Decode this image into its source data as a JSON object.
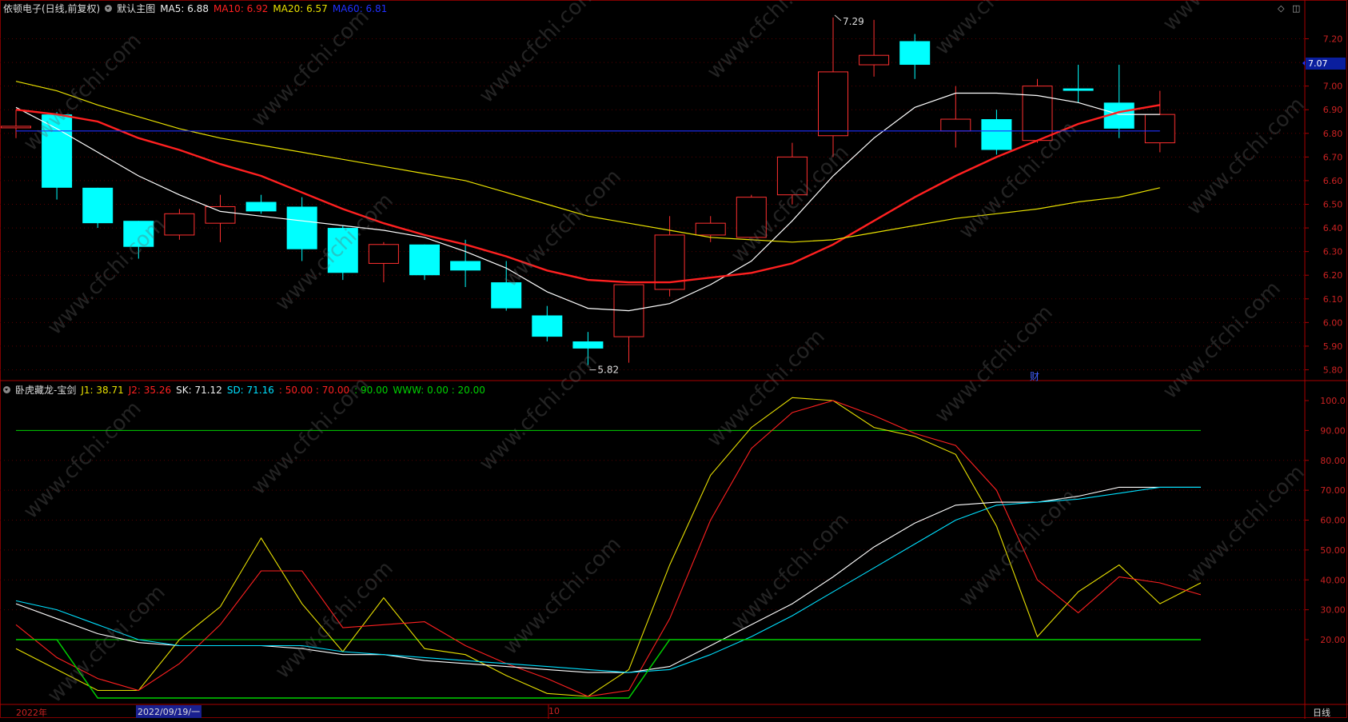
{
  "header_main": {
    "stock": "依顿电子(日线,前复权)",
    "chart_name": "默认主图",
    "ma5": "MA5: 6.88",
    "ma10": "MA10: 6.92",
    "ma20": "MA20: 6.57",
    "ma60": "MA60: 6.81"
  },
  "header_sub": {
    "indicator": "卧虎藏龙-宝剑",
    "j1": "J1: 38.71",
    "j2": "J2: 35.26",
    "sk": "SK: 71.12",
    "sd": "SD: 71.16",
    "lines_red": ": 50.00 : 70.00",
    "lines_green": ": 90.00",
    "www": "WWW: 0.00 : 20.00"
  },
  "current_price": "7.07",
  "finance_flag": "财",
  "bottom": {
    "year": "2022年",
    "date": "2022/09/19/一",
    "month": "10",
    "period": "日线"
  },
  "colors": {
    "up": "#ff3030",
    "down": "#00ffff",
    "ma5": "#ffffff",
    "ma10": "#ff2020",
    "ma20": "#e8e000",
    "ma60": "#2030ff",
    "j1": "#e8e000",
    "j2": "#ff2020",
    "sk": "#ffffff",
    "sd": "#00e0ff",
    "www": "#00d000"
  },
  "chart_data": [
    {
      "type": "candlestick",
      "title": "依顿电子(日线,前复权)",
      "ylim": [
        5.76,
        7.3
      ],
      "yticks": [
        "5.80",
        "5.90",
        "6.00",
        "6.10",
        "6.20",
        "6.30",
        "6.40",
        "6.50",
        "6.60",
        "6.70",
        "6.80",
        "6.90",
        "7.00",
        "7.10",
        "7.20"
      ],
      "annotations": [
        {
          "label": "7.29",
          "index": 20,
          "value": 7.29
        },
        {
          "label": "5.82",
          "index": 14,
          "value": 5.82
        }
      ],
      "candles": [
        {
          "o": 6.83,
          "h": 6.9,
          "l": 6.78,
          "c": 6.83
        },
        {
          "o": 6.88,
          "h": 6.89,
          "l": 6.52,
          "c": 6.57
        },
        {
          "o": 6.57,
          "h": 6.57,
          "l": 6.4,
          "c": 6.42
        },
        {
          "o": 6.43,
          "h": 6.43,
          "l": 6.27,
          "c": 6.32
        },
        {
          "o": 6.37,
          "h": 6.48,
          "l": 6.35,
          "c": 6.46
        },
        {
          "o": 6.42,
          "h": 6.54,
          "l": 6.34,
          "c": 6.49
        },
        {
          "o": 6.51,
          "h": 6.54,
          "l": 6.46,
          "c": 6.47
        },
        {
          "o": 6.49,
          "h": 6.53,
          "l": 6.26,
          "c": 6.31
        },
        {
          "o": 6.4,
          "h": 6.41,
          "l": 6.18,
          "c": 6.21
        },
        {
          "o": 6.25,
          "h": 6.34,
          "l": 6.17,
          "c": 6.33
        },
        {
          "o": 6.33,
          "h": 6.33,
          "l": 6.18,
          "c": 6.2
        },
        {
          "o": 6.26,
          "h": 6.35,
          "l": 6.15,
          "c": 6.22
        },
        {
          "o": 6.17,
          "h": 6.26,
          "l": 6.05,
          "c": 6.06
        },
        {
          "o": 6.03,
          "h": 6.07,
          "l": 5.92,
          "c": 5.94
        },
        {
          "o": 5.92,
          "h": 5.96,
          "l": 5.82,
          "c": 5.89
        },
        {
          "o": 5.94,
          "h": 6.16,
          "l": 5.83,
          "c": 6.16
        },
        {
          "o": 6.14,
          "h": 6.45,
          "l": 6.11,
          "c": 6.37
        },
        {
          "o": 6.37,
          "h": 6.45,
          "l": 6.34,
          "c": 6.42
        },
        {
          "o": 6.36,
          "h": 6.54,
          "l": 6.36,
          "c": 6.53
        },
        {
          "o": 6.54,
          "h": 6.76,
          "l": 6.5,
          "c": 6.7
        },
        {
          "o": 6.79,
          "h": 7.29,
          "l": 6.7,
          "c": 7.06
        },
        {
          "o": 7.09,
          "h": 7.28,
          "l": 7.04,
          "c": 7.13
        },
        {
          "o": 7.19,
          "h": 7.22,
          "l": 7.03,
          "c": 7.09
        },
        {
          "o": 6.81,
          "h": 7.0,
          "l": 6.74,
          "c": 6.86
        },
        {
          "o": 6.86,
          "h": 6.9,
          "l": 6.71,
          "c": 6.73
        },
        {
          "o": 6.77,
          "h": 7.03,
          "l": 6.76,
          "c": 7.0
        },
        {
          "o": 6.99,
          "h": 7.09,
          "l": 6.93,
          "c": 6.98
        },
        {
          "o": 6.93,
          "h": 7.09,
          "l": 6.78,
          "c": 6.82
        },
        {
          "o": 6.76,
          "h": 6.98,
          "l": 6.72,
          "c": 6.88
        }
      ],
      "series": [
        {
          "name": "MA5",
          "values": [
            6.91,
            6.82,
            6.72,
            6.62,
            6.54,
            6.47,
            6.45,
            6.43,
            6.41,
            6.39,
            6.36,
            6.3,
            6.23,
            6.13,
            6.06,
            6.05,
            6.08,
            6.16,
            6.26,
            6.43,
            6.62,
            6.78,
            6.91,
            6.97,
            6.97,
            6.96,
            6.93,
            6.88,
            6.88
          ]
        },
        {
          "name": "MA10",
          "values": [
            6.9,
            6.88,
            6.85,
            6.78,
            6.73,
            6.67,
            6.62,
            6.55,
            6.48,
            6.42,
            6.37,
            6.33,
            6.28,
            6.22,
            6.18,
            6.17,
            6.17,
            6.19,
            6.21,
            6.25,
            6.33,
            6.43,
            6.53,
            6.62,
            6.7,
            6.77,
            6.84,
            6.89,
            6.92
          ]
        },
        {
          "name": "MA20",
          "values": [
            7.02,
            6.98,
            6.92,
            6.87,
            6.82,
            6.78,
            6.75,
            6.72,
            6.69,
            6.66,
            6.63,
            6.6,
            6.55,
            6.5,
            6.45,
            6.42,
            6.39,
            6.36,
            6.35,
            6.34,
            6.35,
            6.38,
            6.41,
            6.44,
            6.46,
            6.48,
            6.51,
            6.53,
            6.57
          ]
        },
        {
          "name": "MA60",
          "values": [
            6.81,
            6.81,
            6.81,
            6.81,
            6.81,
            6.81,
            6.81,
            6.81,
            6.81,
            6.81,
            6.81,
            6.81,
            6.81,
            6.81,
            6.81,
            6.81,
            6.81,
            6.81,
            6.81,
            6.81,
            6.81,
            6.81,
            6.81,
            6.81,
            6.81,
            6.81,
            6.81,
            6.81,
            6.81
          ]
        }
      ]
    },
    {
      "type": "line",
      "title": "卧虎藏龙-宝剑",
      "ylim": [
        0,
        103
      ],
      "yticks": [
        "20.00",
        "30.00",
        "40.00",
        "50.00",
        "60.00",
        "70.00",
        "80.00",
        "90.00",
        "100.0"
      ],
      "levels": [
        {
          "value": 20,
          "color": "#00d000"
        },
        {
          "value": 90,
          "color": "#00d000"
        }
      ],
      "series": [
        {
          "name": "J1",
          "values": [
            17,
            10,
            3,
            3,
            20,
            31,
            54,
            32,
            16,
            34,
            17,
            15,
            8,
            2,
            1,
            10,
            45,
            75,
            91,
            101,
            100,
            91,
            88,
            82,
            58,
            21,
            36,
            45,
            32,
            39
          ]
        },
        {
          "name": "J2",
          "values": [
            25,
            14,
            7,
            3,
            12,
            25,
            43,
            43,
            24,
            25,
            26,
            18,
            12,
            7,
            1,
            3,
            27,
            60,
            84,
            96,
            100,
            95,
            89,
            85,
            70,
            40,
            29,
            41,
            39,
            35
          ]
        },
        {
          "name": "SK",
          "values": [
            32,
            27,
            22,
            19,
            18,
            18,
            18,
            17,
            15,
            15,
            13,
            12,
            11,
            10,
            9,
            9,
            11,
            18,
            25,
            32,
            41,
            51,
            59,
            65,
            66,
            66,
            68,
            71,
            71,
            71
          ]
        },
        {
          "name": "SD",
          "values": [
            33,
            30,
            25,
            20,
            18,
            18,
            18,
            18,
            16,
            15,
            14,
            13,
            12,
            11,
            10,
            9,
            10,
            15,
            21,
            28,
            36,
            44,
            52,
            60,
            65,
            66,
            67,
            69,
            71,
            71
          ]
        },
        {
          "name": "WWW",
          "values": [
            20,
            20,
            0,
            0,
            0,
            0,
            0,
            0,
            0,
            0,
            0,
            0,
            0,
            0,
            0,
            0,
            20,
            20,
            20,
            20,
            20,
            20,
            20,
            20,
            20,
            20,
            20,
            20,
            20,
            20
          ]
        }
      ]
    }
  ]
}
